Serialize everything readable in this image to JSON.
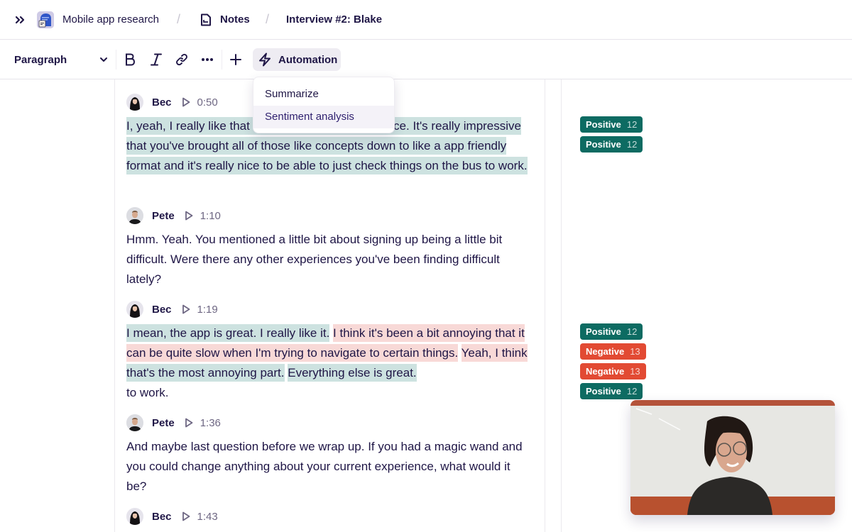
{
  "breadcrumb": {
    "project": "Mobile app research",
    "section": "Notes",
    "current": "Interview #2: Blake",
    "separator": "/"
  },
  "toolbar": {
    "block_type": "Paragraph",
    "automation_label": "Automation",
    "icons": [
      "chevron-down-icon",
      "bold-icon",
      "italic-icon",
      "link-icon",
      "more-icon",
      "plus-icon",
      "lightning-icon"
    ]
  },
  "automation_menu": {
    "items": [
      {
        "label": "Summarize",
        "hovered": false
      },
      {
        "label": "Sentiment analysis",
        "hovered": true
      }
    ]
  },
  "transcript": [
    {
      "speaker": "Bec",
      "time": "0:50",
      "segments": [
        {
          "text": "I, yeah, I really like that the whole mobile experience. It's really impressive that you've brought all of those like concepts down to like a app friendly format and it's really nice to be able to just check things on the bus to work.",
          "sentiment": "positive"
        }
      ]
    },
    {
      "speaker": "Pete",
      "time": "1:10",
      "segments": [
        {
          "text": "Hmm. Yeah. You mentioned a little bit about signing up being a little bit difficult. Were there any other experiences you've been finding difficult lately?",
          "sentiment": "none"
        }
      ]
    },
    {
      "speaker": "Bec",
      "time": "1:19",
      "segments": [
        {
          "text": "I mean, the app is great. I really like it.",
          "sentiment": "positive"
        },
        {
          "text": "I think it's been a bit annoying that it can be quite slow when I'm trying to navigate to certain things.",
          "sentiment": "negative"
        },
        {
          "text": "Yeah, I think",
          "sentiment": "negative"
        },
        {
          "text": "that's the most annoying part.",
          "sentiment": "positive"
        },
        {
          "text": "Everything else is great.",
          "sentiment": "positive"
        }
      ],
      "trailing": "to work."
    },
    {
      "speaker": "Pete",
      "time": "1:36",
      "segments": [
        {
          "text": "And maybe last question before we wrap up. If you had a magic wand and you could change anything about your current experience, what would it be?",
          "sentiment": "none"
        }
      ]
    },
    {
      "speaker": "Bec",
      "time": "1:43",
      "segments": []
    }
  ],
  "sentiment_tags": [
    {
      "label": "Positive",
      "count": "12",
      "type": "positive"
    },
    {
      "label": "Positive",
      "count": "12",
      "type": "positive"
    },
    {
      "label": "Positive",
      "count": "12",
      "type": "positive"
    },
    {
      "label": "Negative",
      "count": "13",
      "type": "negative"
    },
    {
      "label": "Negative",
      "count": "13",
      "type": "negative"
    },
    {
      "label": "Positive",
      "count": "12",
      "type": "positive"
    }
  ],
  "colors": {
    "positive_tag": "#0d6b62",
    "negative_tag": "#e24a33",
    "positive_highlight": "#cde2e0",
    "negative_highlight": "#f8d9d7",
    "text": "#1f1646"
  }
}
